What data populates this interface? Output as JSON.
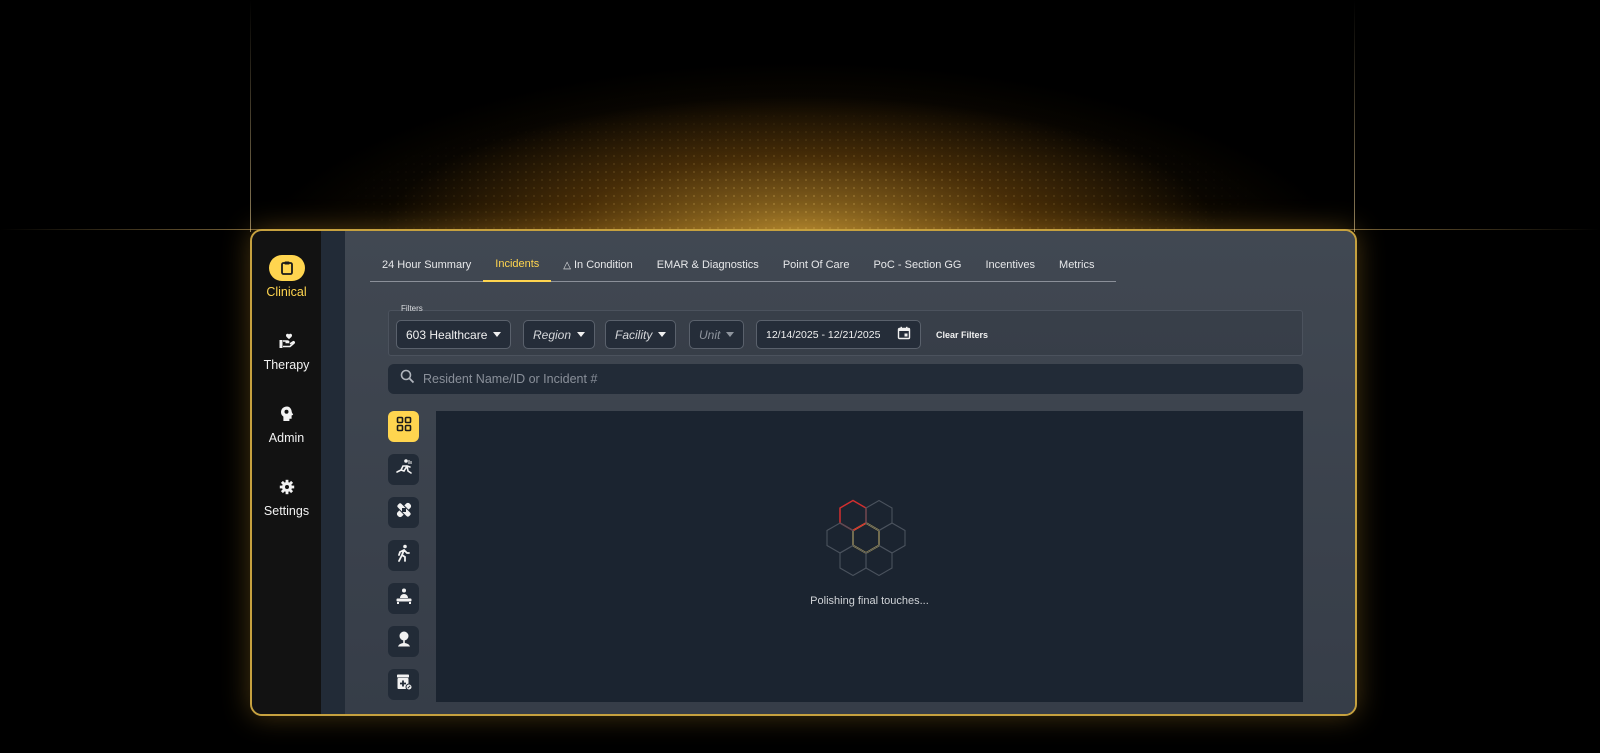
{
  "sidebar": {
    "items": [
      {
        "label": "Clinical",
        "icon": "clipboard-icon",
        "active": true
      },
      {
        "label": "Therapy",
        "icon": "hand-heart-icon",
        "active": false
      },
      {
        "label": "Admin",
        "icon": "head-lightbulb-icon",
        "active": false
      },
      {
        "label": "Settings",
        "icon": "gear-icon",
        "active": false
      }
    ]
  },
  "tabs": [
    {
      "label": "24 Hour Summary",
      "active": false
    },
    {
      "label": "Incidents",
      "active": true
    },
    {
      "label": "In Condition",
      "active": false,
      "icon": "warning-triangle-icon"
    },
    {
      "label": "EMAR & Diagnostics",
      "active": false
    },
    {
      "label": "Point Of Care",
      "active": false
    },
    {
      "label": "PoC - Section GG",
      "active": false
    },
    {
      "label": "Incentives",
      "active": false
    },
    {
      "label": "Metrics",
      "active": false
    }
  ],
  "filters": {
    "legend": "Filters",
    "organization": "603 Healthcare",
    "region_placeholder": "Region",
    "facility_placeholder": "Facility",
    "unit_placeholder": "Unit",
    "date_range": "12/14/2025 - 12/21/2025",
    "clear_label": "Clear Filters"
  },
  "search": {
    "placeholder": "Resident Name/ID or Incident #",
    "icon": "search-icon"
  },
  "categories": [
    {
      "icon": "grid-icon",
      "active": true
    },
    {
      "icon": "fall-icon",
      "active": false
    },
    {
      "icon": "bandage-icon",
      "active": false
    },
    {
      "icon": "walking-person-icon",
      "active": false
    },
    {
      "icon": "person-bed-icon",
      "active": false
    },
    {
      "icon": "person-tree-icon",
      "active": false
    },
    {
      "icon": "medicine-box-icon",
      "active": false
    }
  ],
  "loading": {
    "text": "Polishing final touches..."
  },
  "colors": {
    "accent": "#ffd54f",
    "frame_border": "#c6a13f",
    "loader_active": "#d32f2f"
  }
}
